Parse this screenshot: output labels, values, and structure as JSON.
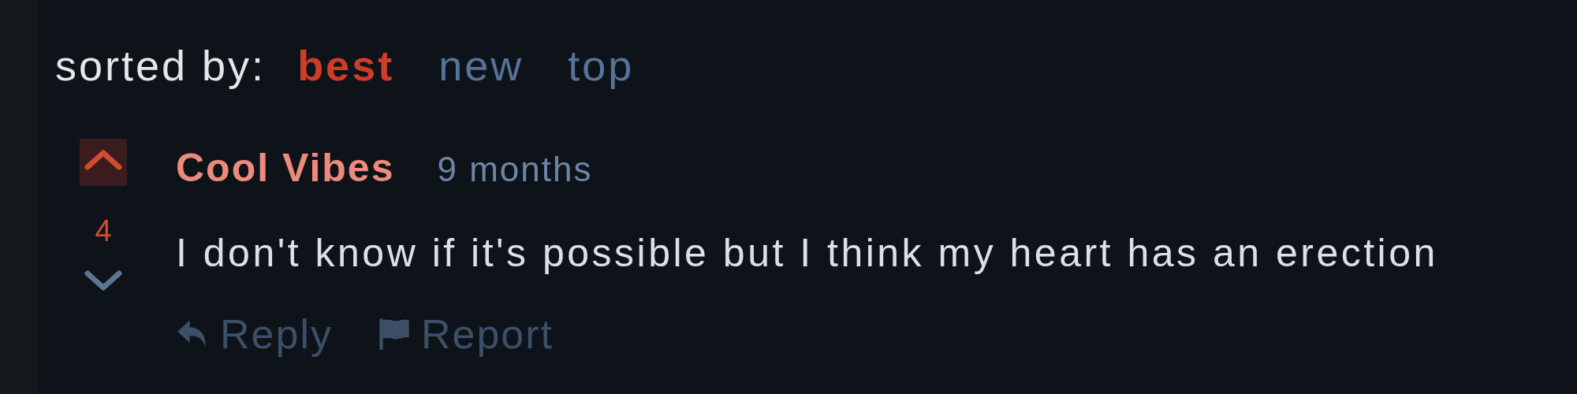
{
  "sort": {
    "label": "sorted by:",
    "options": [
      {
        "label": "best",
        "selected": true
      },
      {
        "label": "new",
        "selected": false
      },
      {
        "label": "top",
        "selected": false
      }
    ]
  },
  "comment": {
    "upvoted": true,
    "downvoted": false,
    "score": "4",
    "author": "Cool Vibes",
    "age": "9 months",
    "body": "I don't know if it's possible but I think my heart has an erection",
    "actions": [
      {
        "kind": "reply",
        "label": "Reply"
      },
      {
        "kind": "report",
        "label": "Report"
      }
    ]
  }
}
